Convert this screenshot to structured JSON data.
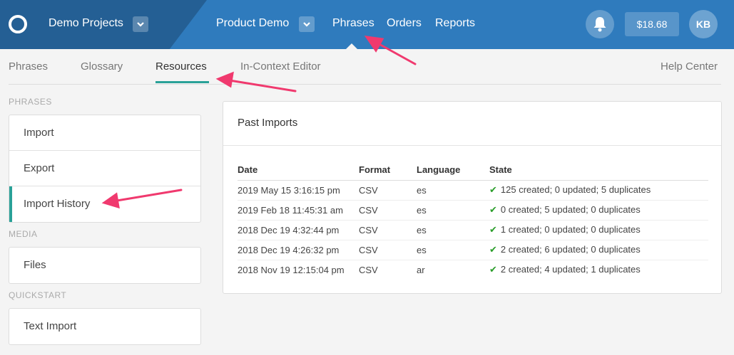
{
  "topbar": {
    "project_name": "Demo Projects",
    "product_name": "Product Demo",
    "nav": [
      "Phrases",
      "Orders",
      "Reports"
    ],
    "balance": "$18.68",
    "avatar_initials": "KB",
    "color": "#2f7bbd",
    "color_dark": "#245f94"
  },
  "subnav": {
    "tabs": [
      "Phrases",
      "Glossary",
      "Resources",
      "In-Context Editor"
    ],
    "active": "Resources",
    "help": "Help Center",
    "accent": "#2aa198"
  },
  "sidebar": {
    "phrases_label": "PHRASES",
    "phrases_items": [
      "Import",
      "Export",
      "Import History"
    ],
    "active_item": "Import History",
    "media_label": "MEDIA",
    "media_items": [
      "Files"
    ],
    "quickstart_label": "QUICKSTART",
    "quickstart_items": [
      "Text Import"
    ]
  },
  "panel": {
    "title": "Past Imports",
    "columns": [
      "Date",
      "Format",
      "Language",
      "State"
    ],
    "rows": [
      {
        "date": "2019 May 15 3:16:15 pm",
        "format": "CSV",
        "language": "es",
        "state": "125 created; 0 updated; 5 duplicates"
      },
      {
        "date": "2019 Feb 18 11:45:31 am",
        "format": "CSV",
        "language": "es",
        "state": "0 created; 5 updated; 0 duplicates"
      },
      {
        "date": "2018 Dec 19 4:32:44 pm",
        "format": "CSV",
        "language": "es",
        "state": "1 created; 0 updated; 0 duplicates"
      },
      {
        "date": "2018 Dec 19 4:26:32 pm",
        "format": "CSV",
        "language": "es",
        "state": "2 created; 6 updated; 0 duplicates"
      },
      {
        "date": "2018 Nov 19 12:15:04 pm",
        "format": "CSV",
        "language": "ar",
        "state": "2 created; 4 updated; 1 duplicates"
      }
    ],
    "state_icon": "check-icon",
    "check_color": "#2a9d2a"
  },
  "annotations": {
    "arrow_color": "#f0396e"
  }
}
